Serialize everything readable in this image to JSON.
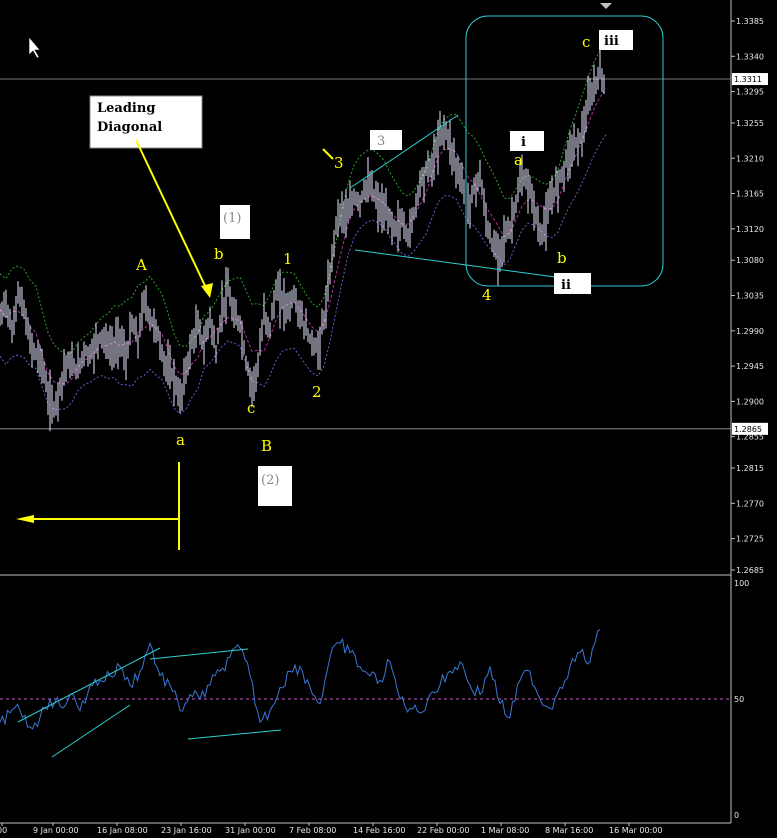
{
  "colors": {
    "background": "#000000",
    "price_bars": "#e8e8ff",
    "upper_band": "#2fa02f",
    "middle_band": "#b0329a",
    "lower_band": "#6a5acd",
    "oscillator": "#3a78d8",
    "trend_lines": "#30d0d0",
    "wave_labels": "#ffff00",
    "level_lines": "#9aa0a6",
    "highlight_box": "#30c8d8",
    "midline": "#c060c0"
  },
  "icons": [
    "cursor-arrow-icon",
    "left-arrow-icon"
  ],
  "chart_data": [
    {
      "type": "ohlc",
      "title": "",
      "price_axis_ticks": [
        "1.3385",
        "1.3340",
        "1.3295",
        "1.3255",
        "1.3210",
        "1.3165",
        "1.3120",
        "1.3080",
        "1.3035",
        "1.2990",
        "1.2945",
        "1.2900",
        "1.2855",
        "1.2815",
        "1.2770",
        "1.2725",
        "1.2685"
      ],
      "ylim": [
        1.2685,
        1.3385
      ],
      "current_price": "1.3311",
      "marked_low": "1.2865",
      "time_axis_ticks": [
        "00",
        "9 Jan 00:00",
        "16 Jan 08:00",
        "23 Jan 16:00",
        "31 Jan 00:00",
        "7 Feb 08:00",
        "14 Feb 16:00",
        "22 Feb 00:00",
        "1 Mar 08:00",
        "8 Mar 16:00",
        "16 Mar 00:00"
      ],
      "close_path": {
        "x": [
          0,
          6,
          12,
          18,
          24,
          30,
          36,
          42,
          48,
          54,
          60,
          66,
          72,
          78,
          84,
          90,
          96,
          102,
          108,
          114,
          120,
          126,
          132,
          138,
          144,
          150,
          156,
          162,
          168,
          174,
          180,
          186,
          192,
          198,
          204,
          210,
          216,
          222,
          228,
          234,
          240,
          246,
          252,
          258,
          264,
          270,
          276,
          282,
          288,
          294,
          300,
          306,
          312,
          318,
          324,
          330,
          336,
          342,
          348,
          354,
          360,
          366,
          372,
          378,
          384,
          390,
          396,
          402,
          408,
          414,
          420,
          426,
          432,
          438,
          444,
          450,
          456,
          462,
          468,
          474,
          480,
          486,
          492,
          498,
          504,
          510,
          516,
          522,
          528,
          534,
          540,
          546,
          552,
          558,
          564,
          570,
          576,
          582,
          588,
          594,
          600,
          606
        ],
        "y": [
          1.3005,
          1.303,
          1.2985,
          1.304,
          1.3015,
          1.2975,
          1.296,
          1.295,
          1.2905,
          1.289,
          1.292,
          1.295,
          1.2945,
          1.294,
          1.2965,
          1.296,
          1.2975,
          1.2985,
          1.297,
          1.2965,
          1.2985,
          1.295,
          1.3,
          1.2975,
          1.303,
          1.3005,
          1.2995,
          1.296,
          1.294,
          1.293,
          1.29,
          1.294,
          1.2975,
          1.2995,
          1.297,
          1.301,
          1.296,
          1.302,
          1.304,
          1.3005,
          1.3,
          1.295,
          1.292,
          1.2945,
          1.301,
          1.2995,
          1.304,
          1.303,
          1.302,
          1.3035,
          1.301,
          1.299,
          1.2975,
          1.2965,
          1.3005,
          1.306,
          1.313,
          1.3145,
          1.3135,
          1.316,
          1.3155,
          1.3175,
          1.317,
          1.315,
          1.314,
          1.313,
          1.312,
          1.313,
          1.311,
          1.314,
          1.318,
          1.3195,
          1.32,
          1.323,
          1.325,
          1.323,
          1.32,
          1.318,
          1.315,
          1.317,
          1.319,
          1.313,
          1.31,
          1.309,
          1.311,
          1.312,
          1.3155,
          1.3185,
          1.3175,
          1.315,
          1.311,
          1.313,
          1.316,
          1.318,
          1.32,
          1.322,
          1.323,
          1.324,
          1.3275,
          1.33,
          1.332,
          1.3305
        ]
      }
    },
    {
      "type": "line",
      "title": "",
      "oscillator_axis_ticks": [
        "100",
        "50",
        "0"
      ],
      "ylim": [
        0,
        100
      ],
      "midline": 50,
      "series": [
        {
          "x": [
            0,
            10,
            20,
            30,
            40,
            50,
            60,
            70,
            80,
            90,
            100,
            110,
            120,
            130,
            140,
            150,
            160,
            170,
            180,
            190,
            200,
            210,
            220,
            230,
            240,
            250,
            260,
            270,
            280,
            290,
            300,
            310,
            320,
            330,
            340,
            350,
            360,
            370,
            380,
            390,
            400,
            410,
            420,
            430,
            440,
            450,
            460,
            470,
            480,
            490,
            500,
            510,
            520,
            530,
            540,
            550,
            560,
            570,
            580,
            590,
            600
          ],
          "y": [
            40,
            44,
            45,
            38,
            42,
            50,
            47,
            52,
            45,
            56,
            58,
            60,
            64,
            56,
            62,
            74,
            60,
            56,
            45,
            52,
            50,
            56,
            62,
            68,
            72,
            60,
            40,
            45,
            55,
            62,
            64,
            55,
            48,
            68,
            74,
            70,
            64,
            60,
            58,
            66,
            50,
            46,
            44,
            52,
            56,
            62,
            66,
            56,
            52,
            64,
            48,
            42,
            58,
            62,
            50,
            46,
            55,
            64,
            70,
            66,
            80
          ]
        }
      ]
    }
  ],
  "labels": {
    "leading_diagonal": [
      "Leading",
      "Diagonal"
    ],
    "wave_A": "A",
    "wave_B": "B",
    "wave_a_low": "a",
    "wave_b": "b",
    "wave_c_low": "c",
    "wave_1": "1",
    "wave_2": "2",
    "wave_3": "3",
    "wave_4": "4",
    "wave_a_box": "a",
    "wave_b_box": "b",
    "wave_c_box": "c",
    "box_grey_3": "3",
    "box_1": "(1)",
    "box_2": "(2)",
    "box_i": "i",
    "box_ii": "ii",
    "box_iii": "iii"
  }
}
